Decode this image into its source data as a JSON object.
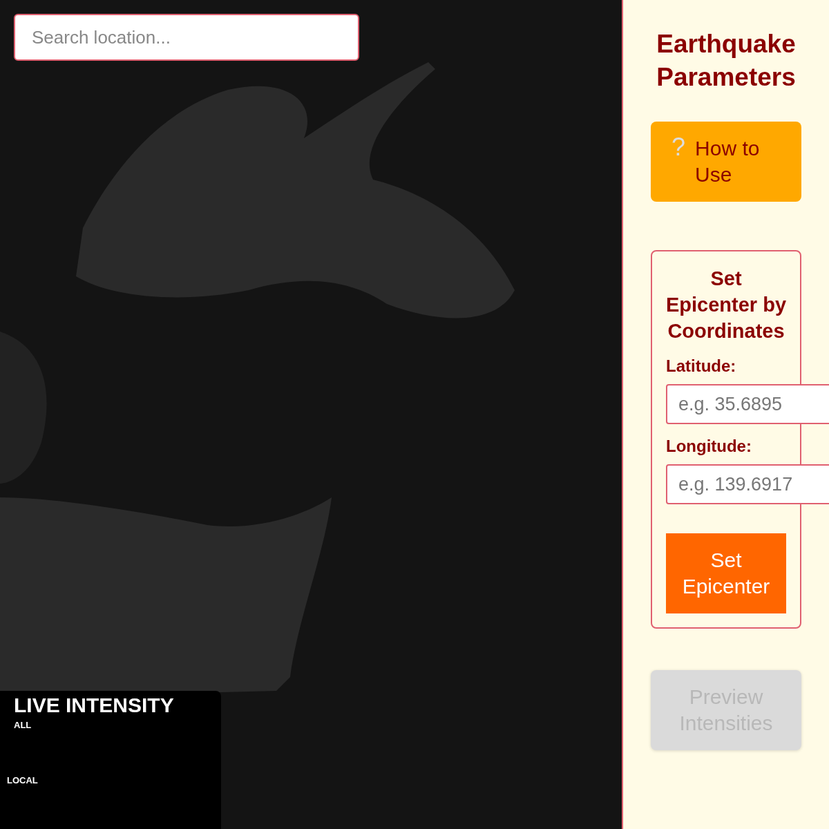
{
  "search": {
    "placeholder": "Search location..."
  },
  "intensity_panel": {
    "title": "LIVE INTENSITY",
    "filters": [
      {
        "label": "ALL"
      },
      {
        "label": "LOCAL"
      }
    ]
  },
  "sidebar": {
    "title": "Earthquake Parameters",
    "help_button": {
      "icon": "?",
      "label": "How to Use"
    },
    "coordinates": {
      "title": "Set Epicenter by Coordinates",
      "fields": [
        {
          "label": "Latitude:",
          "placeholder": "e.g. 35.6895"
        },
        {
          "label": "Longitude:",
          "placeholder": "e.g. 139.6917"
        }
      ],
      "button": "Set Epicenter"
    },
    "preview_button": {
      "label": "Preview Intensities",
      "disabled": true
    }
  }
}
